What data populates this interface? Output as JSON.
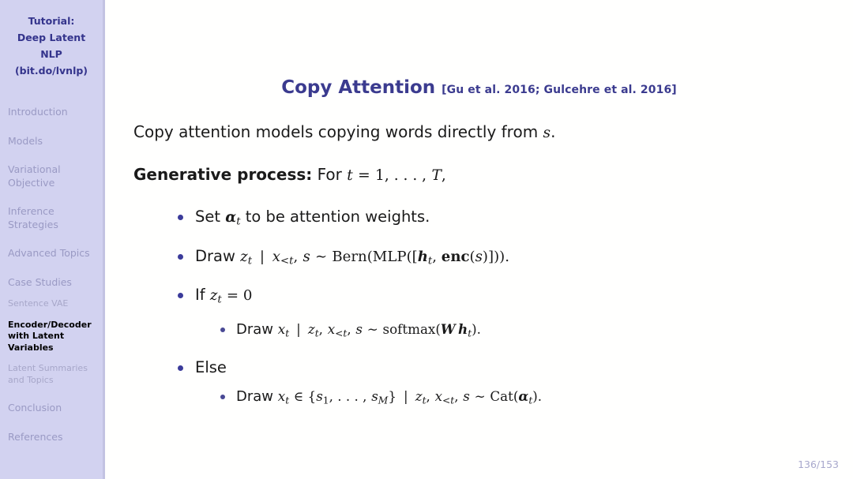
{
  "sidebar": {
    "title_lines": [
      "Tutorial:",
      "Deep Latent NLP",
      "(bit.do/lvnlp)"
    ],
    "items": [
      {
        "label": "Introduction",
        "level": 1,
        "active": false
      },
      {
        "label": "Models",
        "level": 1,
        "active": false
      },
      {
        "label": "Variational Objective",
        "level": 1,
        "active": false
      },
      {
        "label": "Inference Strategies",
        "level": 1,
        "active": false
      },
      {
        "label": "Advanced Topics",
        "level": 1,
        "active": false
      },
      {
        "label": "Case Studies",
        "level": 1,
        "active": false
      },
      {
        "label": "Sentence VAE",
        "level": 2,
        "active": false
      },
      {
        "label": "Encoder/Decoder with Latent Variables",
        "level": 2,
        "active": true
      },
      {
        "label": "Latent Summaries and Topics",
        "level": 2,
        "active": false
      },
      {
        "label": "Conclusion",
        "level": 1,
        "active": false
      },
      {
        "label": "References",
        "level": 1,
        "active": false
      }
    ]
  },
  "slide": {
    "title": "Copy Attention",
    "citation": "[Gu et al. 2016; Gulcehre et al. 2016]",
    "intro": "Copy attention models copying words directly from s.",
    "generative_label": "Generative process:",
    "generative_rest": "For t = 1, . . . , T,",
    "bullets": [
      {
        "text": "Set αt to be attention weights."
      },
      {
        "text": "Draw zt | x<t, s ~ Bern(MLP([ht, enc(s)]))."
      },
      {
        "text": "If zt = 0",
        "sub": [
          "Draw xt | zt, x<t, s ~ softmax(W ht)."
        ]
      },
      {
        "text": "Else",
        "sub": [
          "Draw xt ∈ {s1, . . . , sM} | zt, x<t, s ~ Cat(αt)."
        ]
      }
    ],
    "page_number": "136/153"
  },
  "colors": {
    "sidebar_bg": "#d2d2f0",
    "sidebar_title": "#34348c",
    "sidebar_inactive": "#9a9ac4",
    "sidebar_active": "#000000",
    "title": "#3b3b8f",
    "bullet": "#3b3b9a",
    "page_number": "#a8a8cc",
    "content_bg": "#fffffe"
  }
}
